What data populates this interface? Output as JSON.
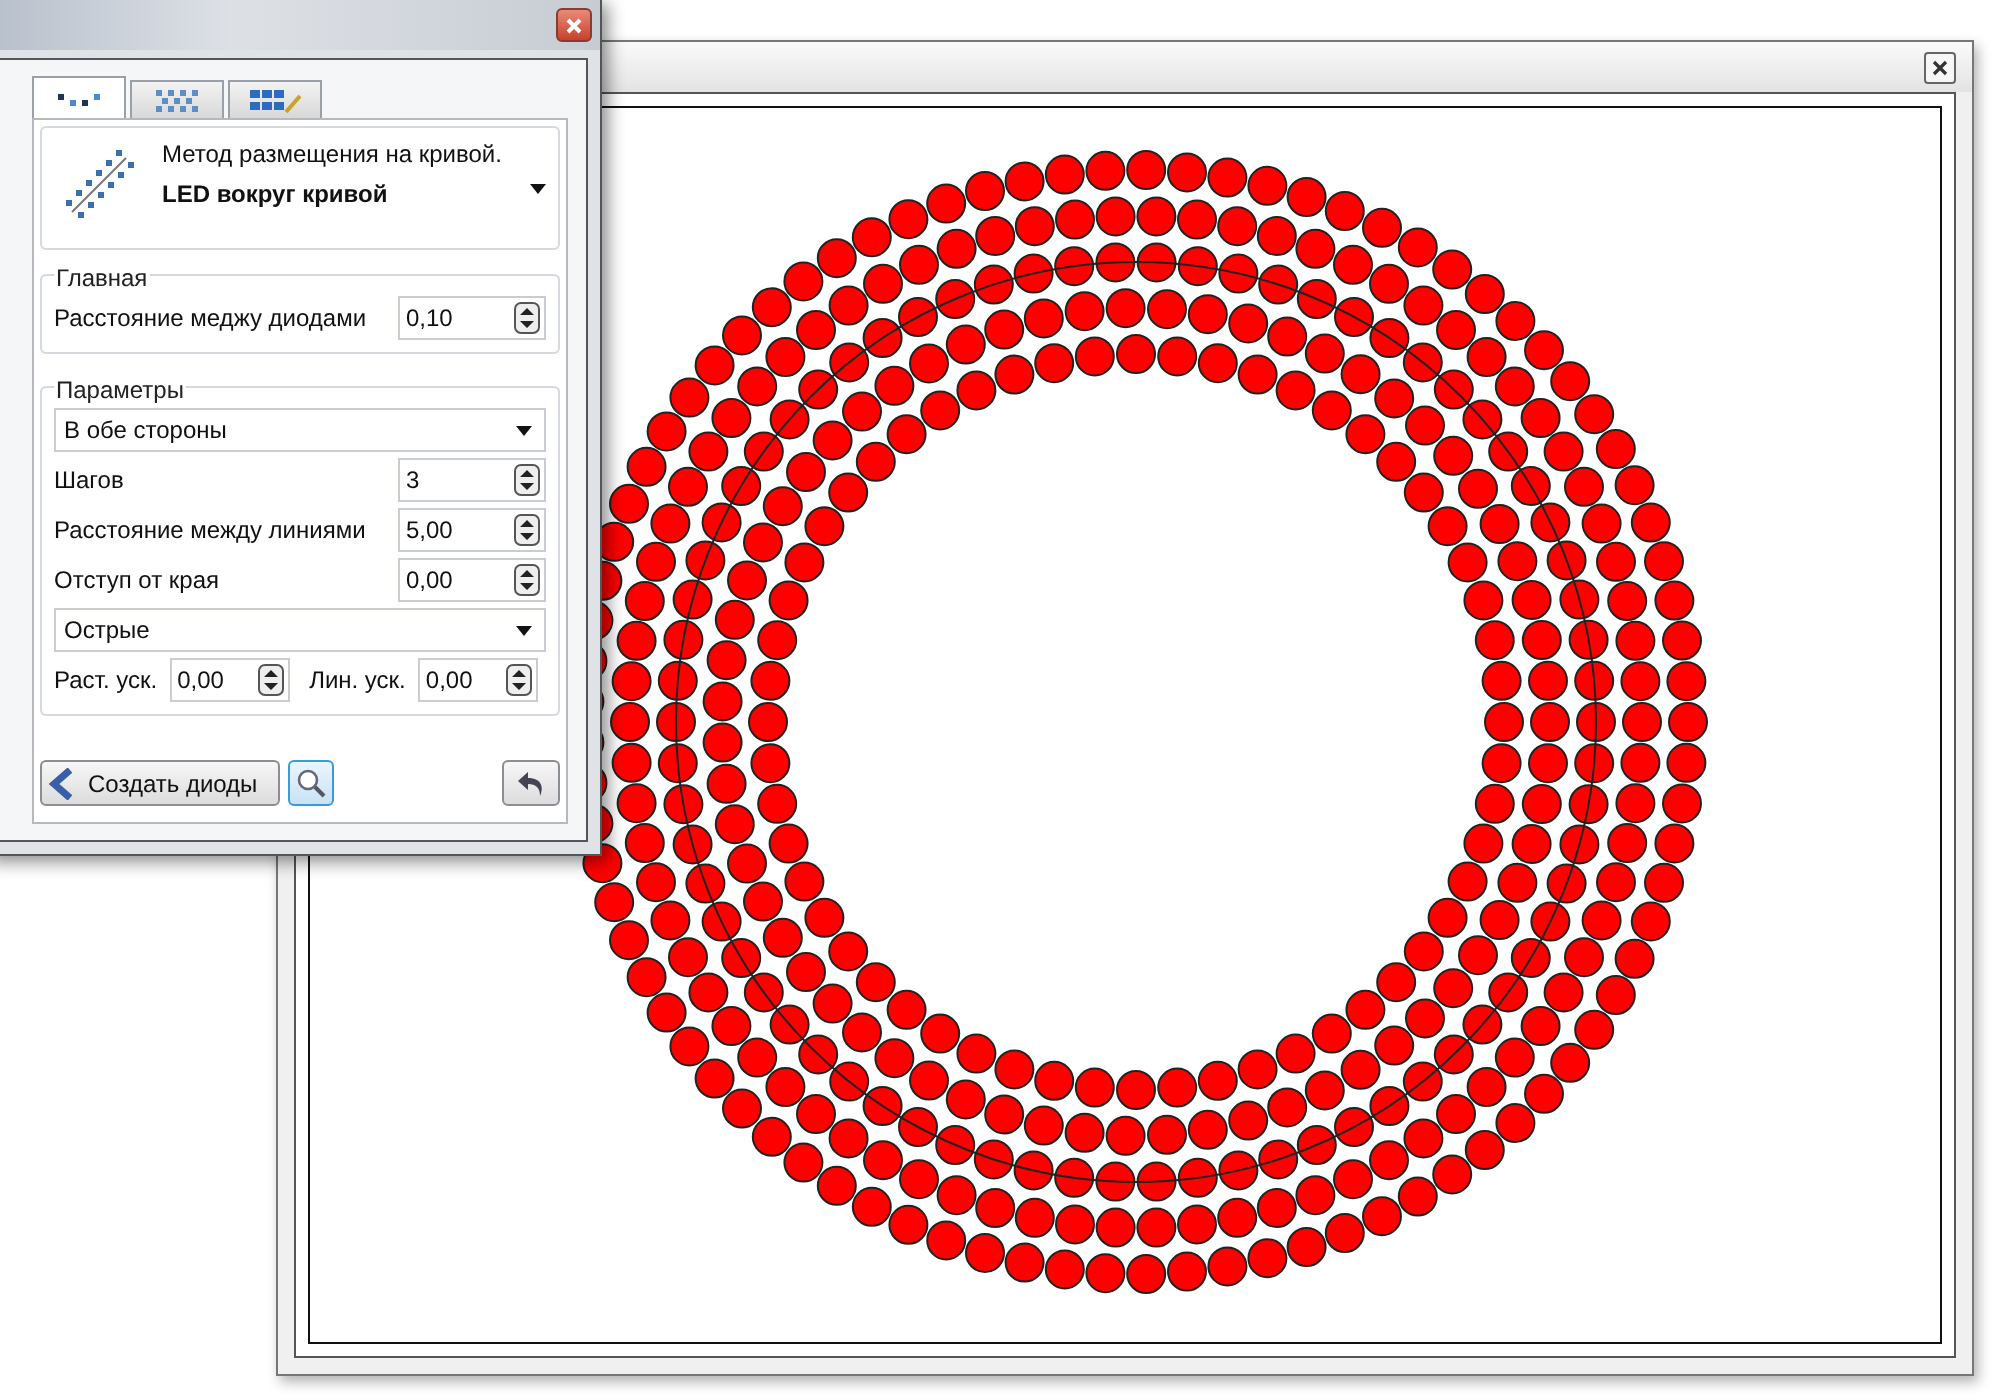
{
  "panel": {
    "tabs": [
      {
        "selected": true
      },
      {
        "selected": false
      },
      {
        "selected": false
      }
    ],
    "method": {
      "caption": "Метод размещения на кривой.",
      "value": "LED вокруг кривой"
    },
    "main_group": {
      "title": "Главная",
      "fields": [
        {
          "label": "Расстояние меджу диодами",
          "value": "0,10"
        }
      ]
    },
    "params_group": {
      "title": "Параметры",
      "items": [
        {
          "kind": "dropdown",
          "value": "В обе стороны"
        },
        {
          "kind": "spin",
          "label": "Шагов",
          "value": "3"
        },
        {
          "kind": "spin",
          "label": "Расстояние между линиями",
          "value": "5,00"
        },
        {
          "kind": "spin",
          "label": "Отступ от края",
          "value": "0,00"
        },
        {
          "kind": "dropdown",
          "value": "Острые"
        },
        {
          "kind": "pair",
          "fields": [
            {
              "label": "Раст. уск.",
              "value": "0,00"
            },
            {
              "label": "Лин. уск.",
              "value": "0,00"
            }
          ]
        }
      ]
    },
    "buttons": [
      {
        "kind": "create",
        "label": "Создать диоды"
      },
      {
        "kind": "search",
        "active": true
      },
      {
        "kind": "undo"
      }
    ]
  }
}
